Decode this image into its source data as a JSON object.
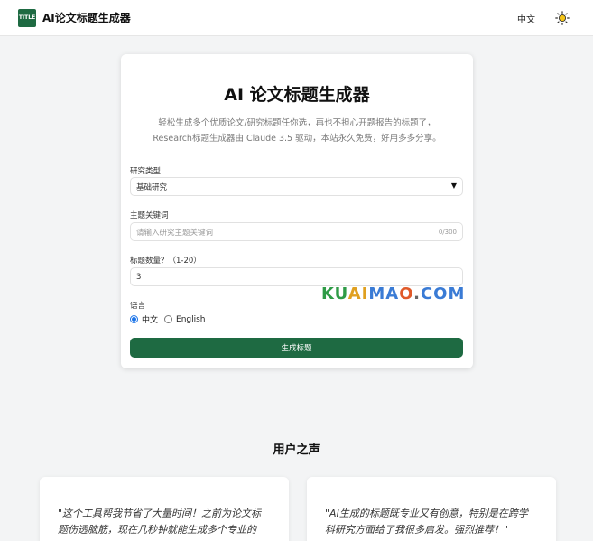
{
  "header": {
    "logo_text": "TITLE",
    "brand": "AI论文标题生成器",
    "language": "中文",
    "theme_icon": "sun-icon"
  },
  "form": {
    "title": "AI 论文标题生成器",
    "description_line1": "轻松生成多个优质论文/研究标题任你选，再也不担心开题报告的标题了，",
    "description_line2": "Research标题生成器由 Claude 3.5 驱动，本站永久免费，好用多多分享。",
    "type_label": "研究类型",
    "type_value": "基础研究",
    "keyword_label": "主题关键词",
    "keyword_placeholder": "请输入研究主题关键词",
    "keyword_counter": "0/300",
    "count_label": "标题数量？（1-20）",
    "count_value": "3",
    "language_label": "语言",
    "lang_option_zh": "中文",
    "lang_option_en": "English",
    "submit_label": "生成标题"
  },
  "watermark": {
    "letters": [
      "K",
      "U",
      "A",
      "I",
      "M",
      "A",
      "O",
      ".",
      "C",
      "O",
      "M"
    ],
    "colors": [
      "#2e9b46",
      "#2e9b46",
      "#e0a020",
      "#e0a020",
      "#3a7bd5",
      "#3a7bd5",
      "#e05a2a",
      "#666666",
      "#3a7bd5",
      "#3a7bd5",
      "#3a7bd5"
    ]
  },
  "testimonials": {
    "section_title": "用户之声",
    "items": [
      {
        "line1": "\"这个工具帮我节省了大量时间！之前为论文标",
        "line2": "题伤透脑筋，现在几秒钟就能生成多个专业的"
      },
      {
        "line1": "\"AI生成的标题既专业又有创意，特别是在跨学",
        "line2": "科研究方面给了我很多启发。强烈推荐！\""
      }
    ]
  }
}
